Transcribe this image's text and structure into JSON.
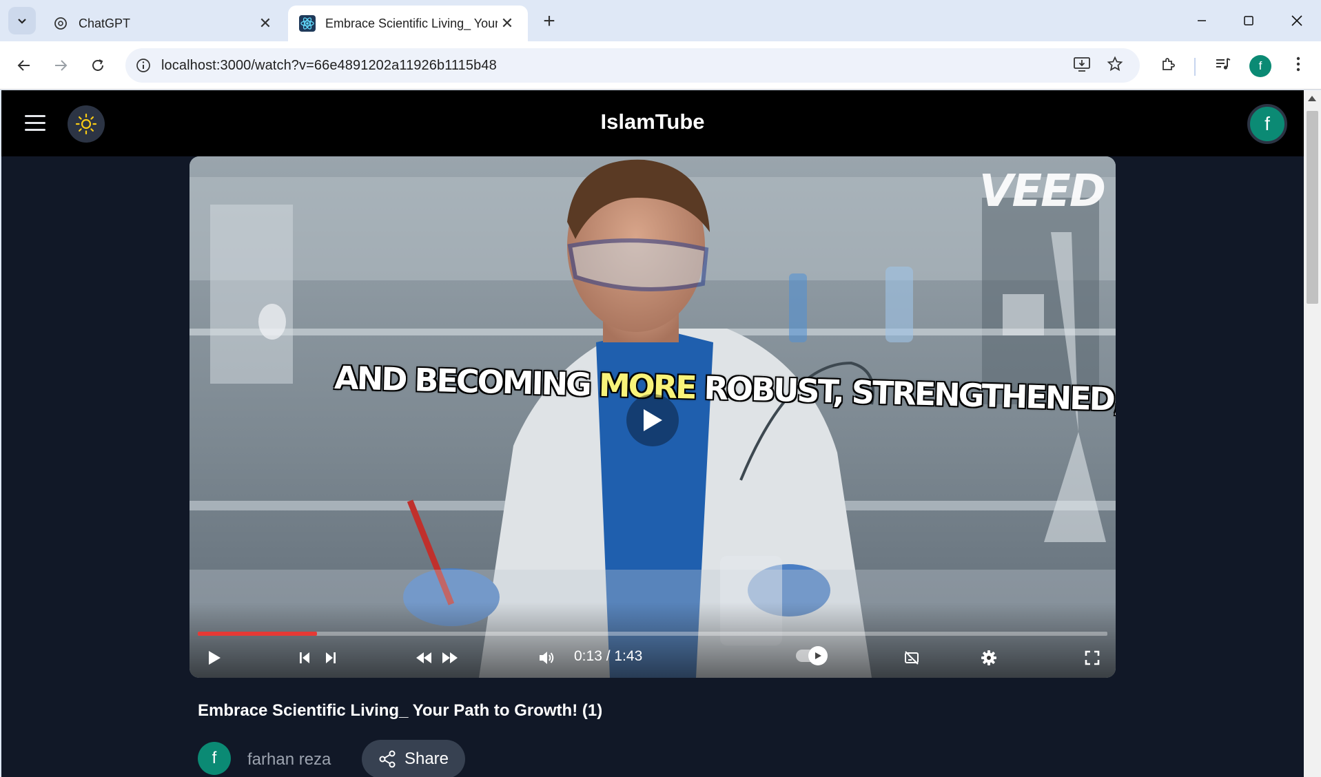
{
  "browser": {
    "tabs": [
      {
        "title": "ChatGPT",
        "icon": "chatgpt-icon",
        "active": false
      },
      {
        "title": "Embrace Scientific Living_ Your",
        "icon": "react-icon",
        "active": true
      }
    ],
    "url": "localhost:3000/watch?v=66e4891202a11926b1115b48",
    "profile_initial": "f"
  },
  "app": {
    "brand": "IslamTube",
    "user_initial": "f"
  },
  "player": {
    "watermark": "VEED",
    "caption_part1": "AND BECOMING",
    "caption_highlight": "MORE",
    "caption_part2": "ROBUST, STRENGTHENED,",
    "time_display": "0:13 / 1:43",
    "progress_fraction": 0.131,
    "accent_color": "#e53935"
  },
  "video": {
    "title": "Embrace Scientific Living_ Your Path to Growth! (1)",
    "channel_name": "farhan reza",
    "channel_initial": "f",
    "share_label": "Share"
  }
}
